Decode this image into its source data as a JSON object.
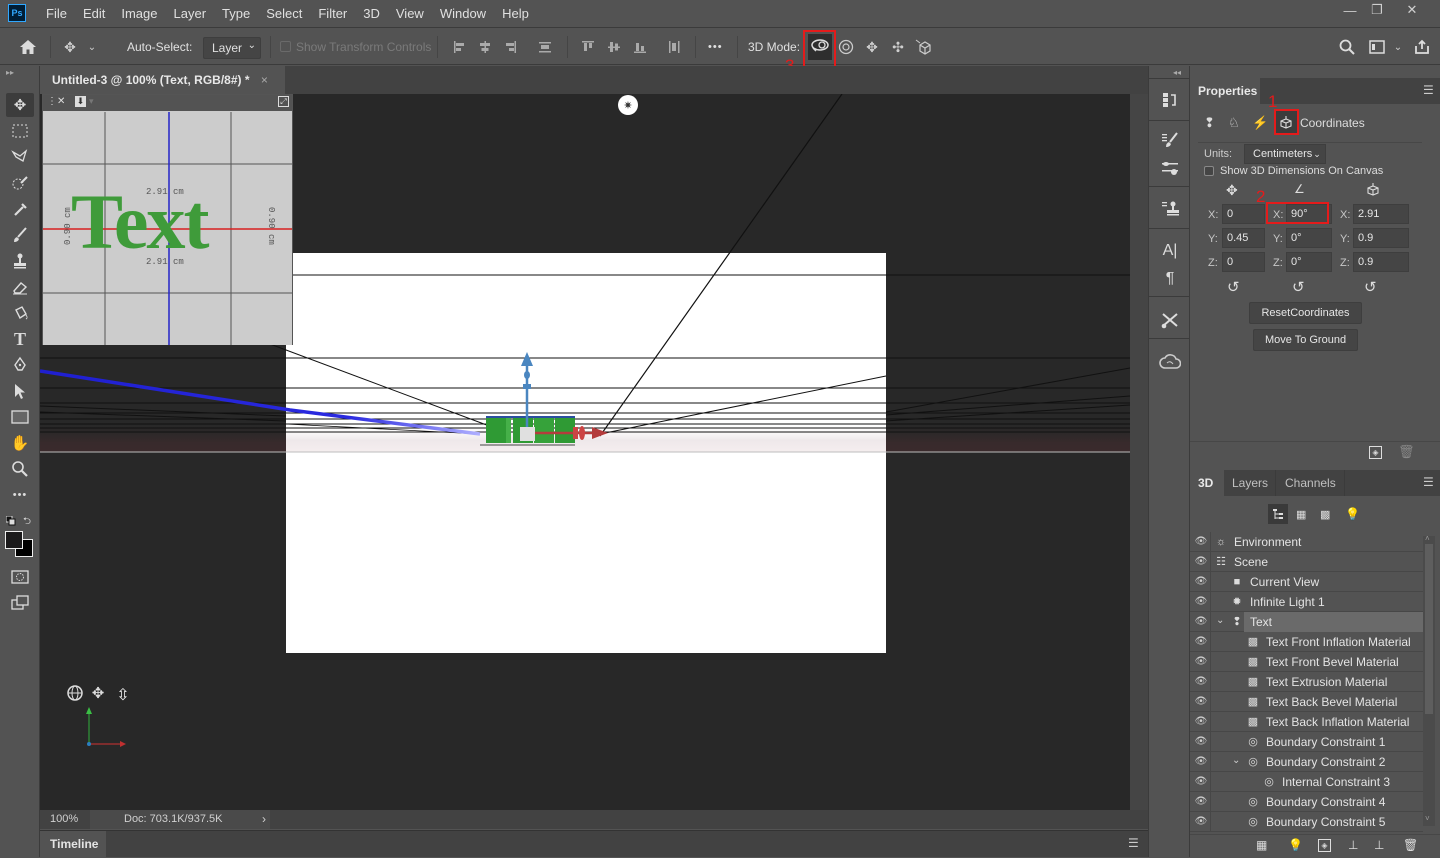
{
  "app": {
    "logo": "Ps"
  },
  "menu": [
    "File",
    "Edit",
    "Image",
    "Layer",
    "Type",
    "Select",
    "Filter",
    "3D",
    "View",
    "Window",
    "Help"
  ],
  "window_controls": {
    "minimize": "—",
    "restore": "❐",
    "close": "✕"
  },
  "options": {
    "auto_select_label": "Auto-Select:",
    "auto_select_checked": true,
    "auto_select_target": "Layer",
    "show_transform_label": "Show Transform Controls",
    "more_label": "•••",
    "mode_3d_label": "3D Mode:",
    "annotation_3": "3"
  },
  "document": {
    "tab_title": "Untitled-3 @ 100% (Text, RGB/8#) *",
    "close": "×",
    "zoom": "100%",
    "doc_info": "Doc: 703.1K/937.5K",
    "status_arrow": "›"
  },
  "mini_view": {
    "text": "Text",
    "dim_width": "2.91 cm",
    "dim_height": "0.90 cm",
    "text_color": "#3f9b3a"
  },
  "timeline": {
    "label": "Timeline"
  },
  "properties": {
    "title": "Properties",
    "section": "Coordinates",
    "annotation_1": "1",
    "annotation_2": "2",
    "units_label": "Units:",
    "units_value": "Centimeters",
    "show_dims_label": "Show 3D Dimensions On Canvas",
    "show_dims_checked": false,
    "position": {
      "x": "0",
      "y": "0.45",
      "z": "0"
    },
    "rotation": {
      "x": "90°",
      "y": "0°",
      "z": "0°"
    },
    "scale": {
      "x": "2.91",
      "y": "0.9",
      "z": "0.9"
    },
    "axis_labels": {
      "x": "X:",
      "y": "Y:",
      "z": "Z:"
    },
    "reset_coords_label": "ResetCoordinates",
    "move_to_ground_label": "Move To Ground"
  },
  "panel3d": {
    "tabs": [
      "3D",
      "Layers",
      "Channels"
    ],
    "active_tab": "3D",
    "items": [
      {
        "label": "Environment",
        "icon": "environment-icon",
        "indent": 0
      },
      {
        "label": "Scene",
        "icon": "scene-icon",
        "indent": 0
      },
      {
        "label": "Current View",
        "icon": "camera-icon",
        "indent": 1
      },
      {
        "label": "Infinite Light 1",
        "icon": "light-icon",
        "indent": 1
      },
      {
        "label": "Text",
        "icon": "mesh-icon",
        "indent": 1,
        "expanded": true,
        "selected": true
      },
      {
        "label": "Text Front Inflation Material",
        "icon": "material-icon",
        "indent": 2
      },
      {
        "label": "Text Front Bevel Material",
        "icon": "material-icon",
        "indent": 2
      },
      {
        "label": "Text Extrusion Material",
        "icon": "material-icon",
        "indent": 2
      },
      {
        "label": "Text Back Bevel Material",
        "icon": "material-icon",
        "indent": 2
      },
      {
        "label": "Text Back Inflation Material",
        "icon": "material-icon",
        "indent": 2
      },
      {
        "label": "Boundary Constraint 1",
        "icon": "constraint-icon",
        "indent": 2
      },
      {
        "label": "Boundary Constraint 2",
        "icon": "constraint-icon",
        "indent": 2,
        "expanded": true
      },
      {
        "label": "Internal Constraint 3",
        "icon": "constraint-icon",
        "indent": 3
      },
      {
        "label": "Boundary Constraint 4",
        "icon": "constraint-icon",
        "indent": 2
      },
      {
        "label": "Boundary Constraint 5",
        "icon": "constraint-icon",
        "indent": 2
      }
    ]
  },
  "colors": {
    "accent_red": "#e41b1b",
    "text_green": "#3f9b3a",
    "axis_blue": "#1f1fd0",
    "axis_red": "#d82020"
  }
}
